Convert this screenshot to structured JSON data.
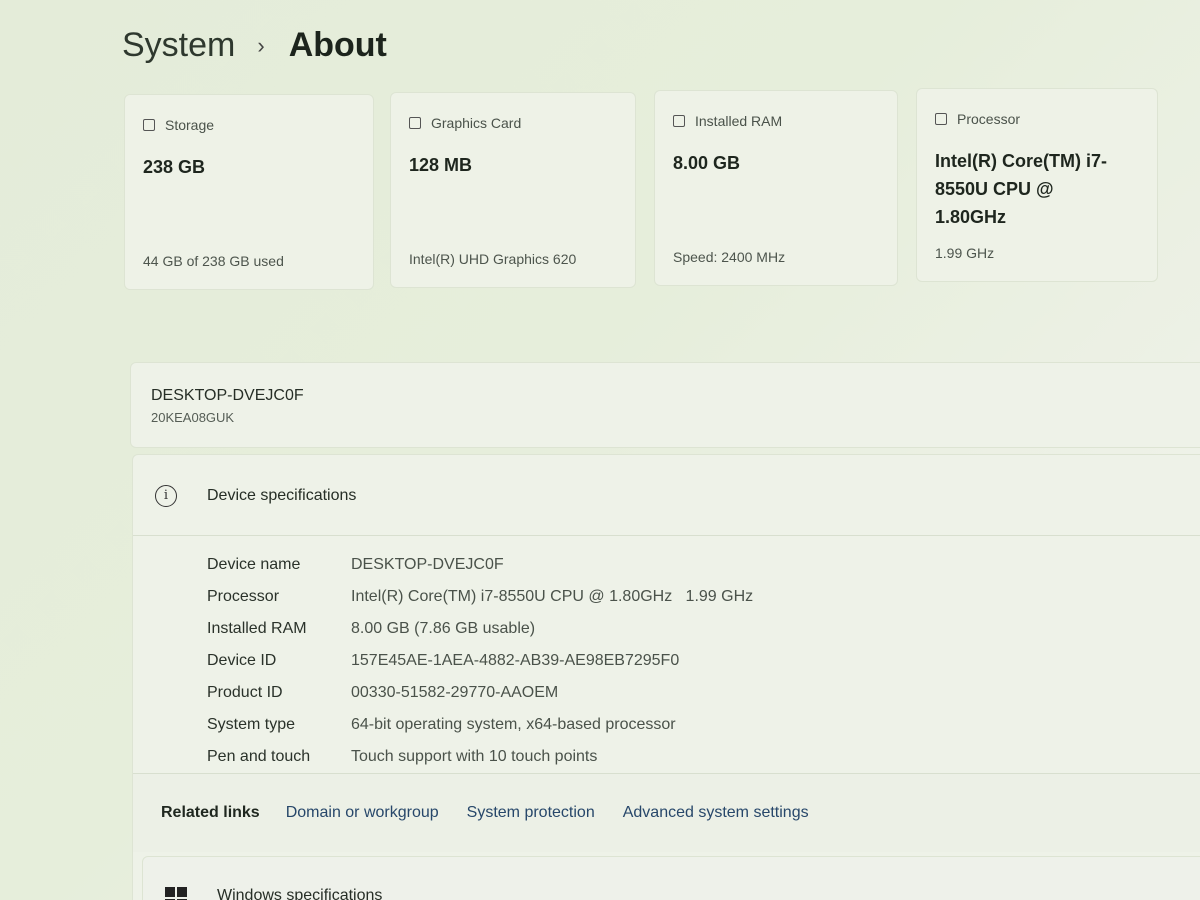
{
  "breadcrumb": {
    "parent": "System",
    "separator": "›",
    "current": "About"
  },
  "cards": [
    {
      "icon": "storage-icon",
      "label": "Storage",
      "value": "238 GB",
      "sub": "44 GB of 238 GB used"
    },
    {
      "icon": "graphics-card-icon",
      "label": "Graphics Card",
      "value": "128 MB",
      "sub": "Intel(R) UHD Graphics 620"
    },
    {
      "icon": "ram-icon",
      "label": "Installed RAM",
      "value": "8.00 GB",
      "sub": "Speed: 2400 MHz"
    },
    {
      "icon": "processor-icon",
      "label": "Processor",
      "value": "Intel(R) Core(TM) i7-8550U CPU @ 1.80GHz",
      "sub": "1.99 GHz"
    }
  ],
  "device": {
    "name": "DESKTOP-DVEJC0F",
    "model": "20KEA08GUK"
  },
  "specs": {
    "title": "Device specifications",
    "rows": [
      {
        "key": "Device name",
        "value": "DESKTOP-DVEJC0F"
      },
      {
        "key": "Processor",
        "value": "Intel(R) Core(TM) i7-8550U CPU @ 1.80GHz   1.99 GHz"
      },
      {
        "key": "Installed RAM",
        "value": "8.00 GB (7.86 GB usable)"
      },
      {
        "key": "Device ID",
        "value": "157E45AE-1AEA-4882-AB39-AE98EB7295F0"
      },
      {
        "key": "Product ID",
        "value": "00330-51582-29770-AAOEM"
      },
      {
        "key": "System type",
        "value": "64-bit operating system, x64-based processor"
      },
      {
        "key": "Pen and touch",
        "value": "Touch support with 10 touch points"
      }
    ]
  },
  "related_links": {
    "label": "Related links",
    "links": [
      "Domain or workgroup",
      "System protection",
      "Advanced system settings"
    ]
  },
  "windows_specs": {
    "title": "Windows specifications"
  }
}
